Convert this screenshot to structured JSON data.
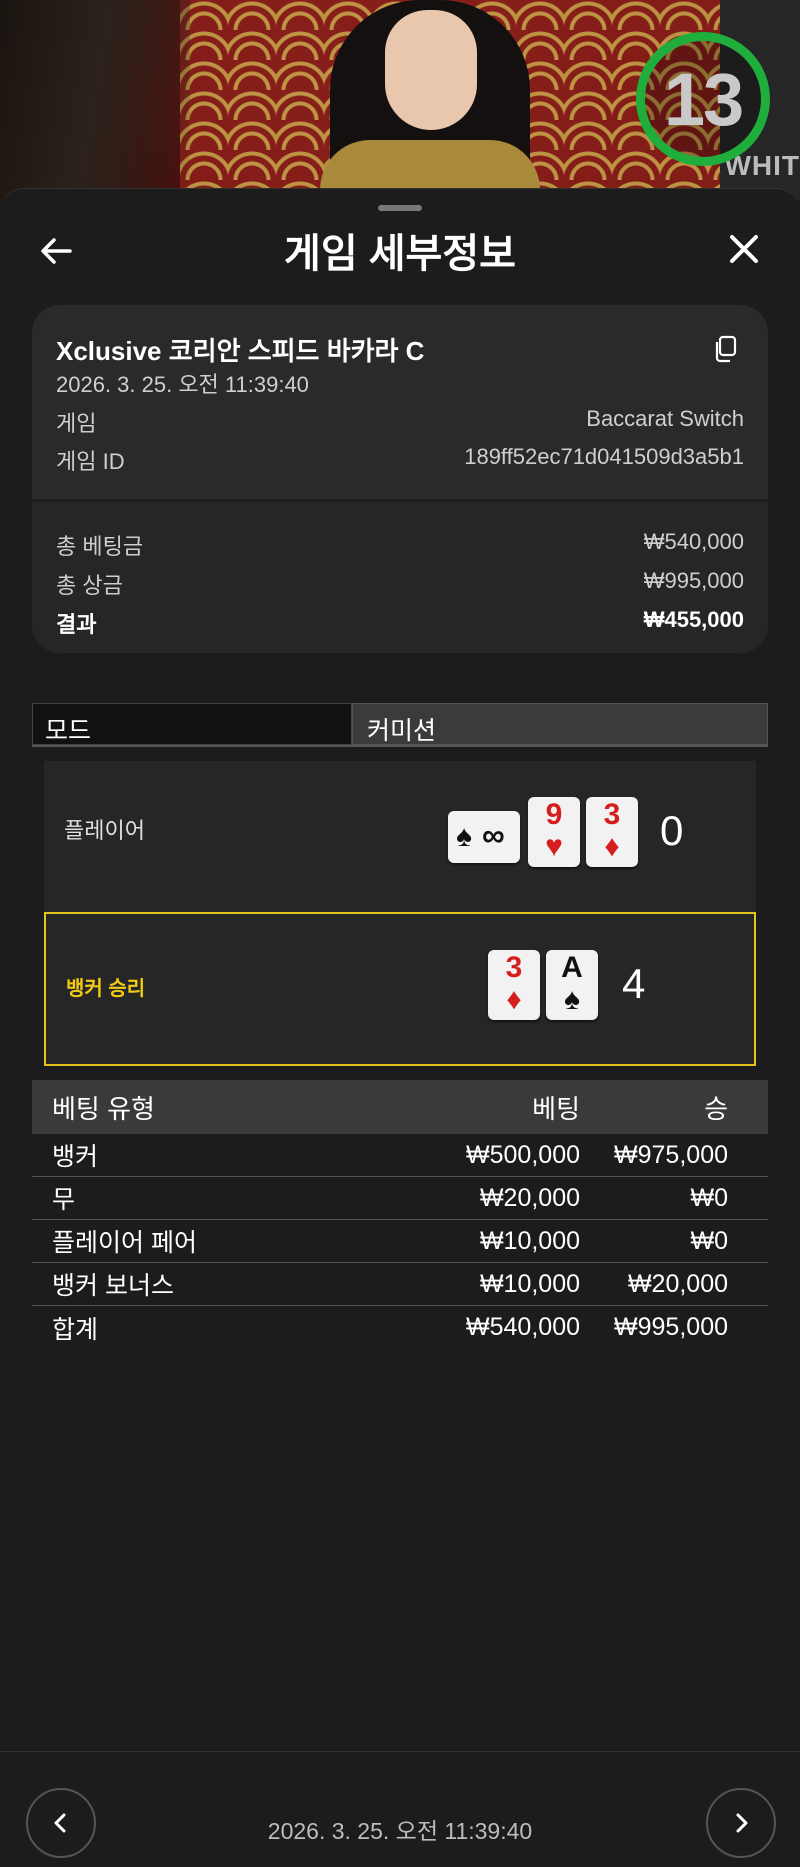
{
  "video": {
    "timer": "13",
    "sign": "WHIT"
  },
  "header": {
    "title": "게임 세부정보"
  },
  "summary": {
    "table_name": "Xclusive 코리안 스피드 바카라 C",
    "datetime": "2026. 3. 25. 오전 11:39:40",
    "game_label": "게임",
    "game_value": "Baccarat Switch",
    "game_id_label": "게임 ID",
    "game_id_value": "189ff52ec71d041509d3a5b1",
    "total_bet_label": "총 베팅금",
    "total_bet_value": "₩540,000",
    "total_win_label": "총 상금",
    "total_win_value": "₩995,000",
    "result_label": "결과",
    "result_value": "₩455,000"
  },
  "mode": {
    "label": "모드",
    "value": "커미션"
  },
  "hands": {
    "player": {
      "label": "플레이어",
      "score": "0",
      "cards": [
        {
          "rank": "∞",
          "suit": "♠",
          "color": "black",
          "orientation": "sideways"
        },
        {
          "rank": "9",
          "suit": "♥",
          "color": "red"
        },
        {
          "rank": "3",
          "suit": "♦",
          "color": "red"
        }
      ]
    },
    "banker": {
      "label": "뱅커 승리",
      "score": "4",
      "cards": [
        {
          "rank": "3",
          "suit": "♦",
          "color": "red"
        },
        {
          "rank": "A",
          "suit": "♠",
          "color": "black"
        }
      ]
    }
  },
  "bets": {
    "headers": [
      "베팅 유형",
      "베팅",
      "승"
    ],
    "rows": [
      [
        "뱅커",
        "₩500,000",
        "₩975,000"
      ],
      [
        "무",
        "₩20,000",
        "₩0"
      ],
      [
        "플레이어 페어",
        "₩10,000",
        "₩0"
      ],
      [
        "뱅커 보너스",
        "₩10,000",
        "₩20,000"
      ],
      [
        "합계",
        "₩540,000",
        "₩995,000"
      ]
    ]
  },
  "footer": {
    "datetime": "2026. 3. 25. 오전 11:39:40"
  },
  "colors": {
    "timer_ring": "#1fae3c",
    "winner_border": "#e3c21c",
    "winner_text": "#f2cc12",
    "card_red": "#d61e1e"
  }
}
